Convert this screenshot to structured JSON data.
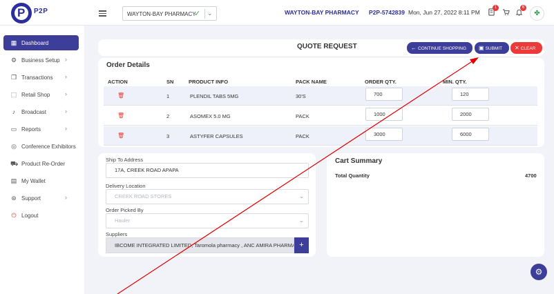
{
  "header": {
    "logo_letter": "P",
    "logo_text": "P2P",
    "pharmacy_select": "WAYTON-BAY PHARMACY",
    "pharmacy_name": "WAYTON-BAY PHARMACY",
    "account_id": "P2P-5742839",
    "datetime": "Mon, Jun 27, 2022 8:11 PM",
    "orders_badge": "1",
    "notifications_badge": "6"
  },
  "sidebar": {
    "items": [
      {
        "label": "Dashboard",
        "icon": "grid-icon"
      },
      {
        "label": "Business Setup",
        "icon": "gear-icon"
      },
      {
        "label": "Transactions",
        "icon": "copy-icon"
      },
      {
        "label": "Retail Shop",
        "icon": "shop-icon"
      },
      {
        "label": "Broadcast",
        "icon": "mic-icon"
      },
      {
        "label": "Reports",
        "icon": "folder-icon"
      },
      {
        "label": "Conference Exhibitors",
        "icon": "target-icon"
      },
      {
        "label": "Product Re-Order",
        "icon": "cart-icon"
      },
      {
        "label": "My Wallet",
        "icon": "wallet-icon"
      },
      {
        "label": "Support",
        "icon": "lifebuoy-icon"
      },
      {
        "label": "Logout",
        "icon": "power-icon"
      }
    ]
  },
  "quote": {
    "title": "QUOTE REQUEST",
    "continue_label": "CONTINUE SHOPPING",
    "submit_label": "SUBMIT",
    "clear_label": "CLEAR"
  },
  "order": {
    "title": "Order Details",
    "columns": [
      "ACTION",
      "SN",
      "PRODUCT INFO",
      "PACK NAME",
      "ORDER QTY.",
      "MIN. QTY."
    ],
    "rows": [
      {
        "sn": "1",
        "product": "PLENDIL TABS 5MG",
        "pack": "30'S",
        "order_qty": "700",
        "min_qty": "120"
      },
      {
        "sn": "2",
        "product": "ASOMEX 5.0 MG",
        "pack": "PACK",
        "order_qty": "1000",
        "min_qty": "2000"
      },
      {
        "sn": "3",
        "product": "ASTYFER CAPSULES",
        "pack": "PACK",
        "order_qty": "3000",
        "min_qty": "6000"
      }
    ]
  },
  "shipping": {
    "ship_label": "Ship To Address",
    "ship_value": "17A, CREEK ROAD APAPA",
    "delivery_label": "Delivery Location",
    "delivery_value": "CREEK ROAD STORES",
    "picked_label": "Order Picked By",
    "picked_value": "Hauler",
    "suppliers_label": "Suppliers",
    "suppliers_value": "IBCOME INTEGRATED LIMITED, Taromola pharmacy , ANC AMIRA PHARMACY"
  },
  "cart": {
    "title": "Cart Summary",
    "total_label": "Total Quantity",
    "total_value": "4700"
  },
  "colors": {
    "primary": "#3d3e9a",
    "danger": "#ec3a3a",
    "success": "#3aa854",
    "annotation": "#e00000"
  }
}
